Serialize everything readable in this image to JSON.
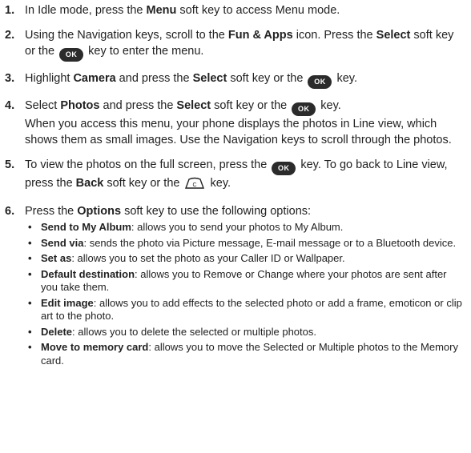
{
  "steps": [
    {
      "num": "1.",
      "t1": "In Idle mode, press the ",
      "b1": "Menu",
      "t2": " soft key to access Menu mode."
    },
    {
      "num": "2.",
      "t1": "Using the Navigation keys, scroll to the ",
      "b1": "Fun & Apps",
      "t2": " icon. Press the ",
      "b2": "Select",
      "t3": " soft key or the ",
      "t4": " key to enter the menu."
    },
    {
      "num": "3.",
      "t1": "Highlight ",
      "b1": "Camera",
      "t2": " and press the ",
      "b2": "Select",
      "t3": " soft key or the ",
      "t4": " key."
    },
    {
      "num": "4.",
      "t1": "Select ",
      "b1": "Photos",
      "t2": " and press the ",
      "b2": "Select",
      "t3": " soft key or the ",
      "t4": " key.",
      "extra": "When you access this menu, your phone displays the photos in Line view, which shows them as small images. Use the Navigation keys to scroll through the photos."
    },
    {
      "num": "5.",
      "t1": "To view the photos on the full screen, press the ",
      "t2": " key. To go back to Line view, press the ",
      "b1": "Back",
      "t3": " soft key or the ",
      "t4": " key."
    },
    {
      "num": "6.",
      "t1": "Press the ",
      "b1": "Options",
      "t2": " soft key to use the following options:"
    }
  ],
  "ok_key_label": "OK",
  "bullet_char": "•",
  "options": [
    {
      "label": "Send to My Album",
      "desc": ": allows you to send your photos to My Album."
    },
    {
      "label": "Send via",
      "desc": ": sends the photo via Picture message, E-mail message or to a Bluetooth device."
    },
    {
      "label": "Set as",
      "desc": ": allows you to set the photo as your Caller ID or Wallpaper."
    },
    {
      "label": "Default destination",
      "desc": ": allows you to Remove or Change where your photos are sent after you take them."
    },
    {
      "label": "Edit image",
      "desc": ": allows you to add effects to the selected photo or add a frame, emoticon or clip art to the photo."
    },
    {
      "label": "Delete",
      "desc": ": allows you to delete the selected or multiple photos."
    },
    {
      "label": "Move to memory card",
      "desc": ": allows you to move the Selected or Multiple photos to the Memory card."
    }
  ]
}
